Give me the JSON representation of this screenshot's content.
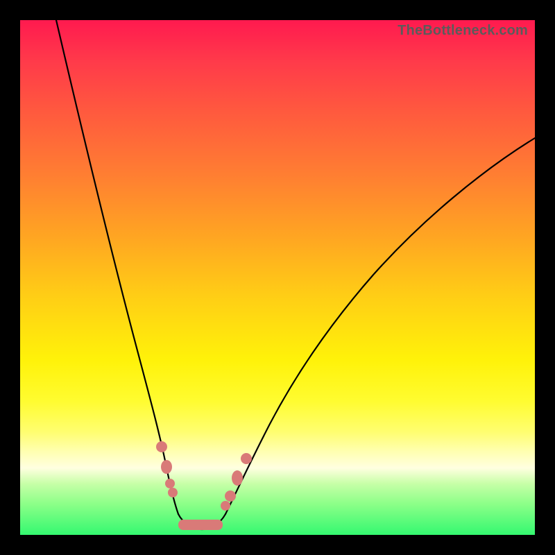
{
  "attribution": "TheBottleneck.com",
  "colors": {
    "background": "#000000",
    "marker": "#d97a78",
    "curve": "#000000"
  },
  "chart_data": {
    "type": "line",
    "title": "",
    "xlabel": "",
    "ylabel": "",
    "xlim": [
      0,
      100
    ],
    "ylim": [
      0,
      100
    ],
    "grid": false,
    "legend": false,
    "series": [
      {
        "name": "left-branch",
        "x": [
          7,
          9,
          12,
          15,
          18,
          21,
          23,
          25,
          26,
          27,
          28,
          29,
          30
        ],
        "y": [
          100,
          88,
          72,
          55,
          40,
          27,
          19,
          12,
          9,
          7,
          5,
          4,
          3
        ]
      },
      {
        "name": "valley",
        "x": [
          30,
          32,
          34,
          36,
          38
        ],
        "y": [
          3,
          2,
          2,
          2,
          3
        ]
      },
      {
        "name": "right-branch",
        "x": [
          38,
          40,
          43,
          47,
          52,
          58,
          65,
          73,
          82,
          91,
          100
        ],
        "y": [
          3,
          5,
          9,
          15,
          23,
          32,
          42,
          52,
          62,
          71,
          78
        ]
      }
    ],
    "annotations": [
      {
        "name": "marker-left-upper",
        "x": 26.2,
        "y": 17.0
      },
      {
        "name": "marker-left-mid",
        "x": 27.3,
        "y": 13.2
      },
      {
        "name": "marker-left-lower-a",
        "x": 28.1,
        "y": 10.5
      },
      {
        "name": "marker-left-lower-b",
        "x": 28.8,
        "y": 8.8
      },
      {
        "name": "marker-valley-a",
        "x": 31.0,
        "y": 3.1
      },
      {
        "name": "marker-valley-b",
        "x": 33.0,
        "y": 2.8
      },
      {
        "name": "marker-valley-c",
        "x": 35.0,
        "y": 2.8
      },
      {
        "name": "marker-valley-d",
        "x": 37.0,
        "y": 3.1
      },
      {
        "name": "marker-right-lower-a",
        "x": 38.5,
        "y": 5.0
      },
      {
        "name": "marker-right-lower-b",
        "x": 39.8,
        "y": 7.8
      },
      {
        "name": "marker-right-mid",
        "x": 41.4,
        "y": 11.2
      },
      {
        "name": "marker-right-upper",
        "x": 43.3,
        "y": 14.8
      }
    ]
  }
}
